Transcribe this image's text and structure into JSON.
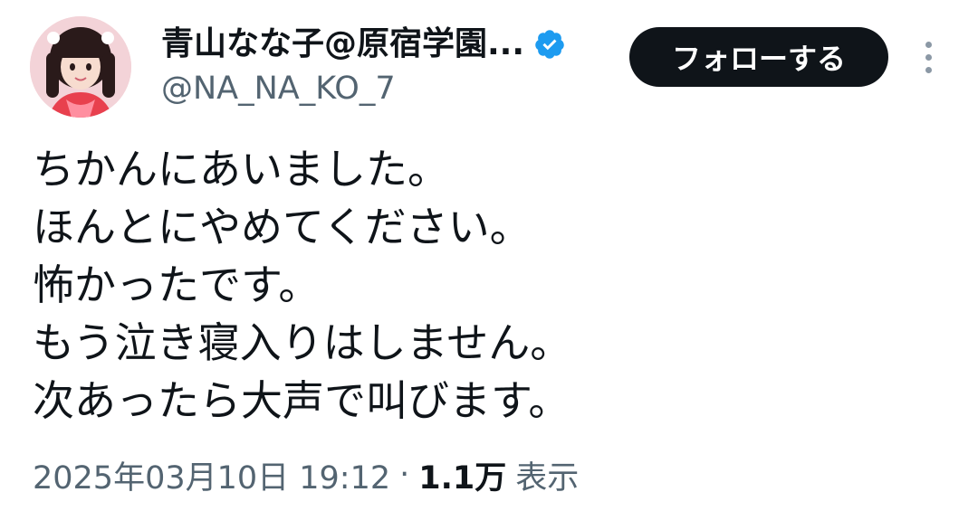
{
  "author": {
    "display_name": "青山なな子@原宿学園...",
    "handle": "@NA_NA_KO_7",
    "verified": true,
    "verified_color": "#1d9bf0"
  },
  "actions": {
    "follow_label": "フォローする",
    "more_icon": "more-vertical-icon"
  },
  "tweet": {
    "lines": [
      "ちかんにあいました。",
      "ほんとにやめてください。",
      "怖かったです。",
      "もう泣き寝入りはしません。",
      "次あったら大声で叫びます。"
    ]
  },
  "meta": {
    "timestamp": "2025年03月10日 19:12",
    "separator": "·",
    "views_count": "1.1万",
    "views_label": "表示"
  },
  "colors": {
    "text": "#0f1419",
    "secondary": "#536471",
    "button_bg": "#0f1419",
    "button_text": "#ffffff"
  }
}
